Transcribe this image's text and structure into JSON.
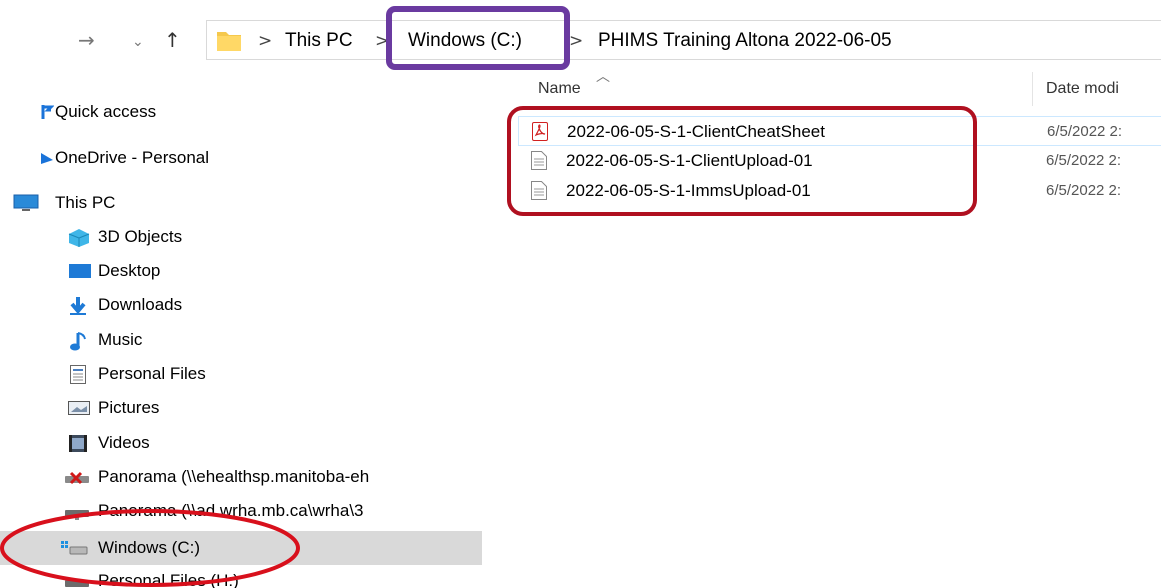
{
  "toolbar": {
    "forward_icon": "arrow-right-icon",
    "recent_icon": "chevron-down-icon",
    "up_icon": "arrow-up-icon"
  },
  "breadcrumb": {
    "items": [
      "This PC",
      "Windows (C:)",
      "PHIMS Training Altona 2022-06-05"
    ],
    "separator": ">"
  },
  "columns": {
    "name": "Name",
    "date": "Date modi"
  },
  "files": [
    {
      "name": "2022-06-05-S-1-ClientCheatSheet",
      "date": "6/5/2022 2:",
      "icon": "pdf-file-icon"
    },
    {
      "name": "2022-06-05-S-1-ClientUpload-01",
      "date": "6/5/2022 2:",
      "icon": "text-file-icon"
    },
    {
      "name": "2022-06-05-S-1-ImmsUpload-01",
      "date": "6/5/2022 2:",
      "icon": "text-file-icon"
    }
  ],
  "sidebar": {
    "items": [
      {
        "label": "Quick access",
        "icon": "quick-access-icon"
      },
      {
        "label": "OneDrive - Personal",
        "icon": "onedrive-icon"
      },
      {
        "label": "This PC",
        "icon": "monitor-icon"
      },
      {
        "label": "3D Objects",
        "icon": "cube-icon"
      },
      {
        "label": "Desktop",
        "icon": "desktop-icon"
      },
      {
        "label": "Downloads",
        "icon": "download-icon"
      },
      {
        "label": "Music",
        "icon": "music-icon"
      },
      {
        "label": "Personal Files",
        "icon": "document-icon"
      },
      {
        "label": "Pictures",
        "icon": "picture-icon"
      },
      {
        "label": "Videos",
        "icon": "video-icon"
      },
      {
        "label": "Panorama (\\\\ehealthsp.manitoba-eh",
        "icon": "disconnected-drive-icon"
      },
      {
        "label": "Panorama (\\\\ad.wrha.mb.ca\\wrha\\3",
        "icon": "network-drive-icon"
      },
      {
        "label": "Windows (C:)",
        "icon": "windows-drive-icon"
      },
      {
        "label": "Personal Files (H:)",
        "icon": "network-drive-icon"
      }
    ]
  },
  "annotations": {
    "breadcrumb_box_color": "#6a3aa0",
    "files_box_color": "#b01020",
    "sidebar_ellipse_color": "#d8101c"
  }
}
